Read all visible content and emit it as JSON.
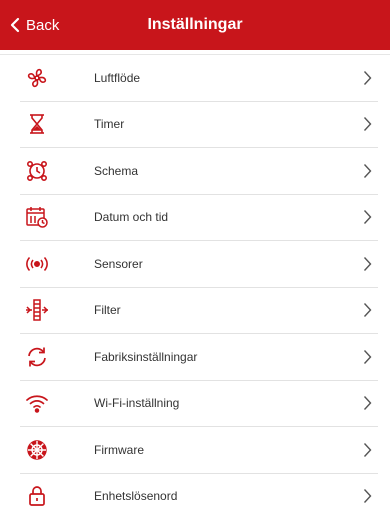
{
  "header": {
    "back_label": "Back",
    "title": "Inställningar"
  },
  "accent_color": "#c8151b",
  "menu": {
    "items": [
      {
        "label": "Luftflöde",
        "icon": "fan-icon"
      },
      {
        "label": "Timer",
        "icon": "hourglass-icon"
      },
      {
        "label": "Schema",
        "icon": "schedule-icon"
      },
      {
        "label": "Datum och tid",
        "icon": "calendar-clock-icon"
      },
      {
        "label": "Sensorer",
        "icon": "sensor-icon"
      },
      {
        "label": "Filter",
        "icon": "filter-icon"
      },
      {
        "label": "Fabriksinställningar",
        "icon": "reset-icon"
      },
      {
        "label": "Wi-Fi-inställning",
        "icon": "wifi-icon"
      },
      {
        "label": "Firmware",
        "icon": "firmware-icon"
      },
      {
        "label": "Enhetslösenord",
        "icon": "lock-icon"
      }
    ]
  }
}
